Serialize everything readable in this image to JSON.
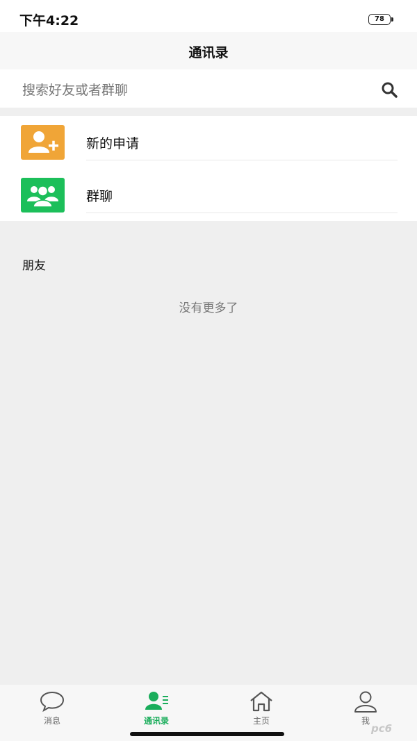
{
  "status_bar": {
    "time": "下午4:22",
    "battery": "78"
  },
  "nav": {
    "title": "通讯录"
  },
  "search": {
    "placeholder": "搜索好友或者群聊",
    "icon": "search-icon"
  },
  "entries": [
    {
      "label": "新的申请",
      "icon": "add-user-icon",
      "color": "#f0a537"
    },
    {
      "label": "群聊",
      "icon": "group-icon",
      "color": "#1cbf5a"
    }
  ],
  "friends": {
    "header": "朋友",
    "empty_text": "没有更多了"
  },
  "tabs": [
    {
      "label": "消息",
      "icon": "chat-bubble-icon",
      "active": false
    },
    {
      "label": "通讯录",
      "icon": "contacts-icon",
      "active": true
    },
    {
      "label": "主页",
      "icon": "home-icon",
      "active": false
    },
    {
      "label": "我",
      "icon": "profile-icon",
      "active": false
    }
  ],
  "colors": {
    "accent": "#1aad5b",
    "orange": "#f0a537",
    "green": "#1cbf5a"
  },
  "watermark": "pc6"
}
